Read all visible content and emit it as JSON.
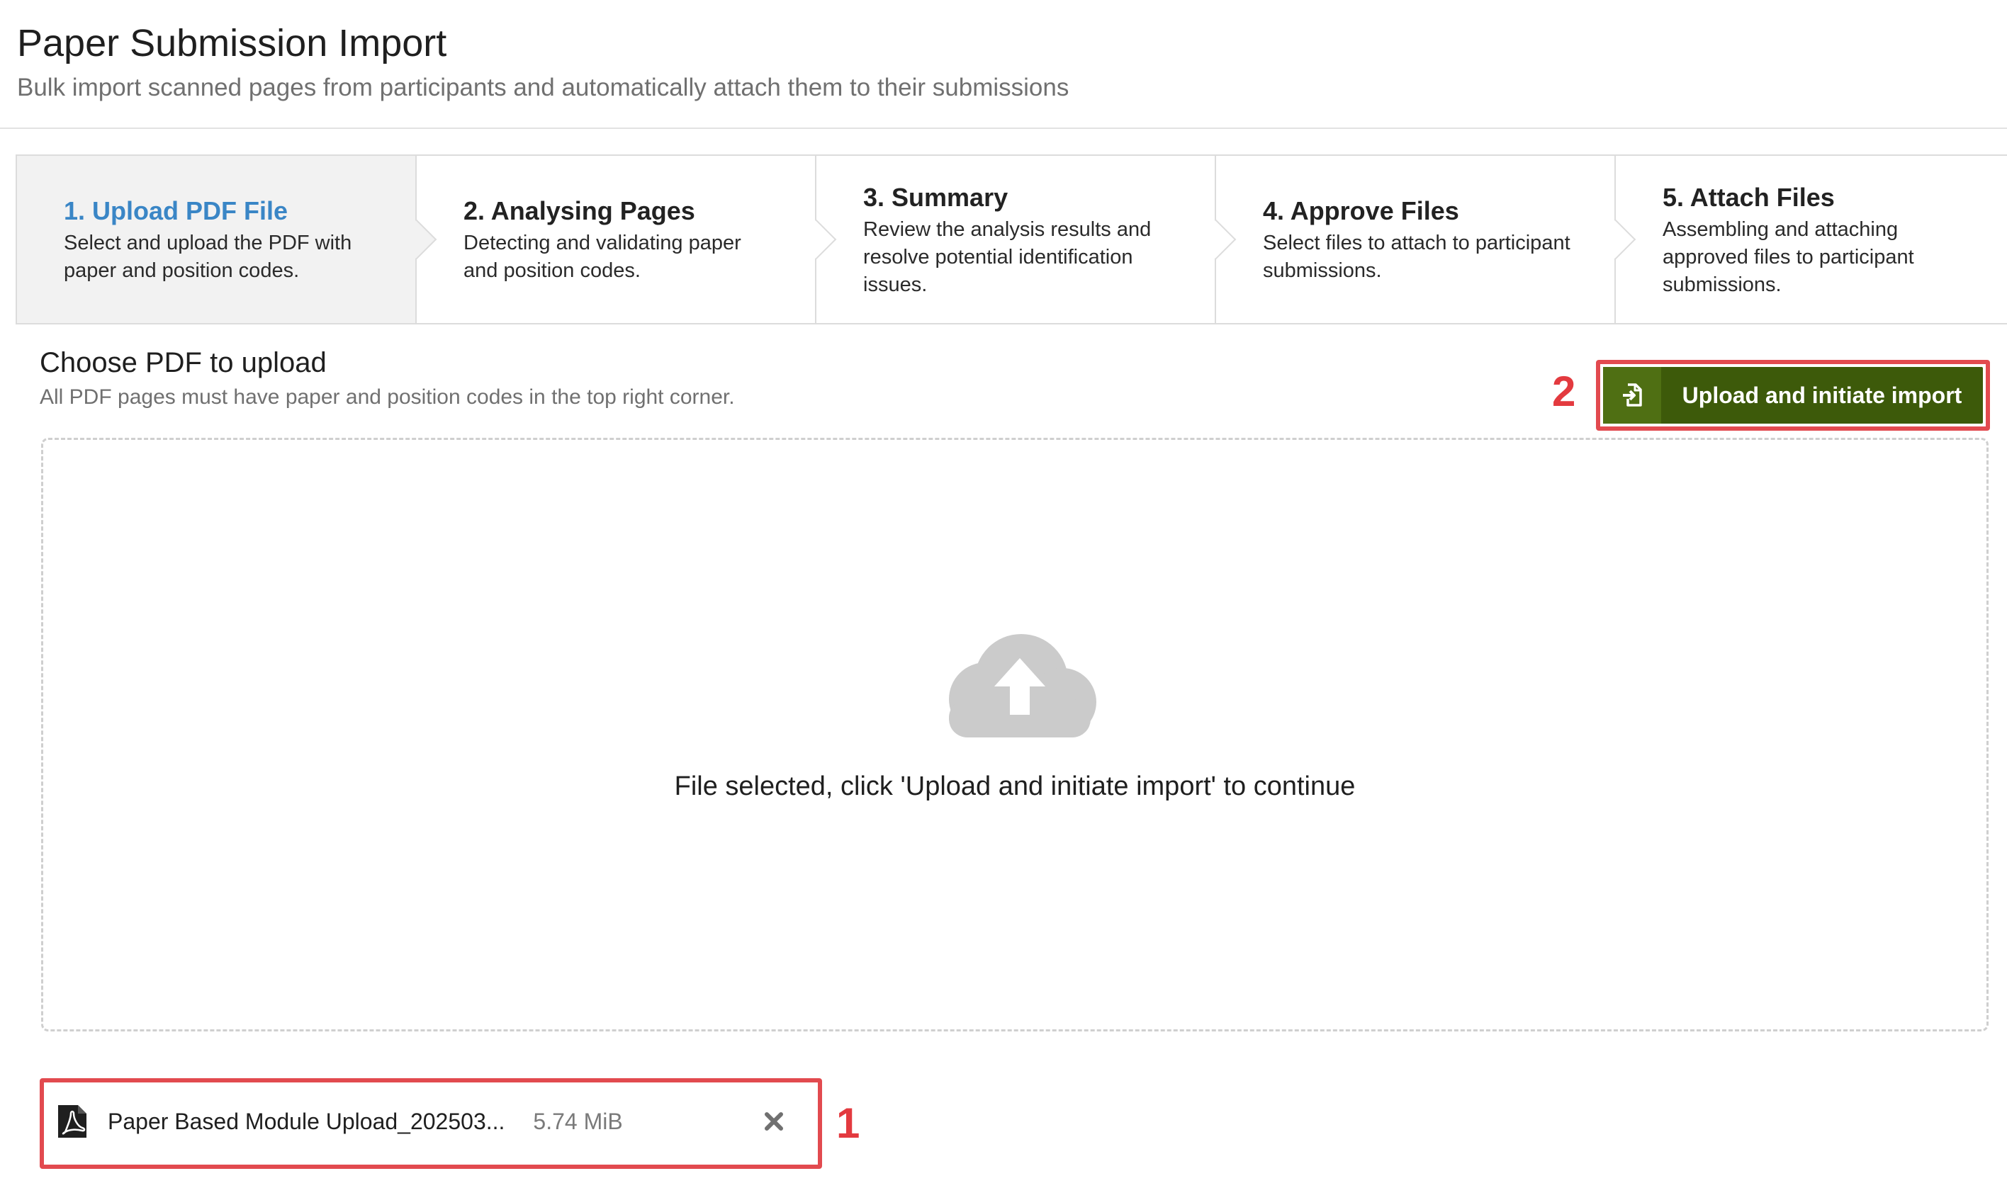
{
  "header": {
    "title": "Paper Submission Import",
    "subtitle": "Bulk import scanned pages from participants and automatically attach them to their submissions"
  },
  "wizard": {
    "steps": [
      {
        "title": "1. Upload PDF File",
        "description": "Select and upload the PDF with paper and position codes.",
        "active": true
      },
      {
        "title": "2. Analysing Pages",
        "description": "Detecting and validating paper and position codes.",
        "active": false
      },
      {
        "title": "3. Summary",
        "description": "Review the analysis results and resolve potential identification issues.",
        "active": false
      },
      {
        "title": "4. Approve Files",
        "description": "Select files to attach to participant submissions.",
        "active": false
      },
      {
        "title": "5. Attach Files",
        "description": "Assembling and attaching approved files to participant submissions.",
        "active": false
      }
    ]
  },
  "choose": {
    "title": "Choose PDF to upload",
    "subtitle": "All PDF pages must have paper and position codes in the top right corner."
  },
  "upload_button": {
    "label": "Upload and initiate import",
    "icon": "file-import-icon",
    "color": "#3d5a0a"
  },
  "dropzone": {
    "icon": "cloud-upload-icon",
    "message": "File selected, click 'Upload and initiate import' to continue"
  },
  "selected_file": {
    "name": "Paper Based Module Upload_202503...",
    "size": "5.74 MiB",
    "icon": "pdf-file-icon",
    "remove_icon": "close-icon"
  },
  "annotations": {
    "marker_1": "1",
    "marker_2": "2",
    "color": "#e24a4f"
  }
}
